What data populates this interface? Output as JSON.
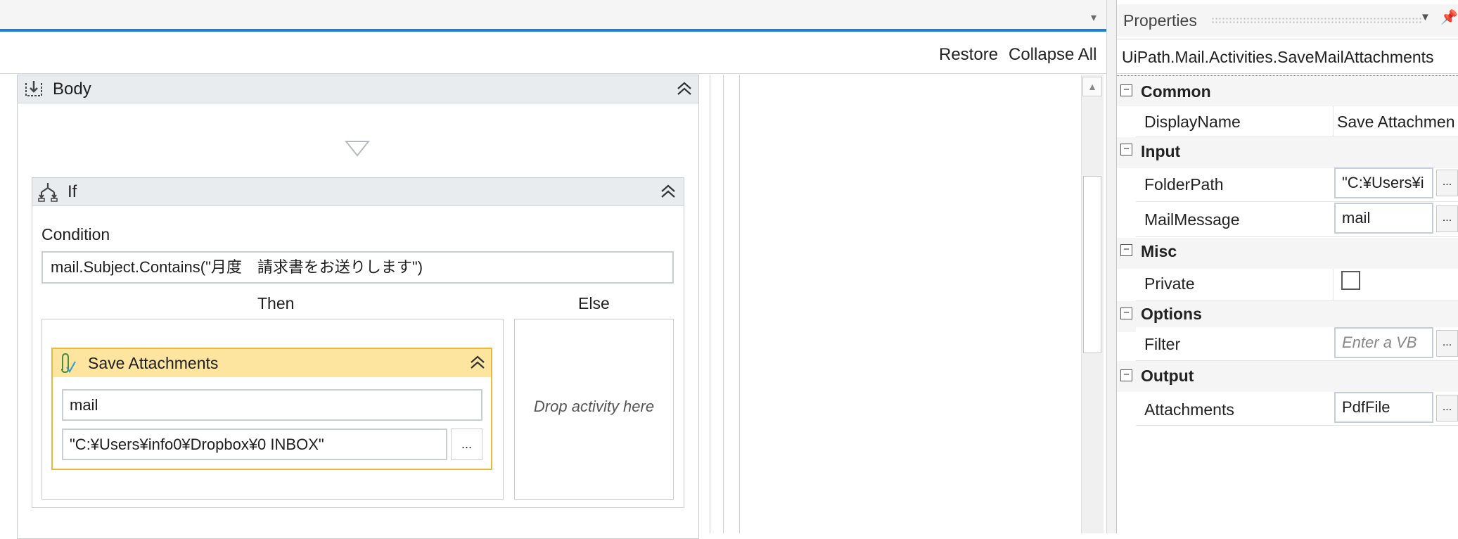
{
  "toolbar": {
    "restore": "Restore",
    "collapse_all": "Collapse All"
  },
  "workflow": {
    "body_title": "Body",
    "if_title": "If",
    "condition_label": "Condition",
    "condition_value": "mail.Subject.Contains(\"月度　請求書をお送りします\")",
    "then_label": "Then",
    "else_label": "Else",
    "drop_hint": "Drop activity here",
    "save_attachments": {
      "title": "Save Attachments",
      "mail_value": "mail",
      "path_value": "\"C:¥Users¥info0¥Dropbox¥0 INBOX\"",
      "browse_label": "..."
    }
  },
  "properties": {
    "title": "Properties",
    "class_name": "UiPath.Mail.Activities.SaveMailAttachments",
    "categories": [
      {
        "label": "Common",
        "toggle": "−",
        "rows": [
          {
            "name": "DisplayName",
            "value": "Save Attachmen"
          }
        ]
      },
      {
        "label": "Input",
        "toggle": "−",
        "rows": [
          {
            "name": "FolderPath",
            "value": "\"C:¥Users¥i"
          },
          {
            "name": "MailMessage",
            "value": "mail"
          }
        ]
      },
      {
        "label": "Misc",
        "toggle": "−",
        "rows": [
          {
            "name": "Private",
            "checked": false
          }
        ]
      },
      {
        "label": "Options",
        "toggle": "−",
        "rows": [
          {
            "name": "Filter",
            "placeholder": "Enter a VB"
          }
        ]
      },
      {
        "label": "Output",
        "toggle": "−",
        "rows": [
          {
            "name": "Attachments",
            "value": "PdfFile"
          }
        ]
      }
    ],
    "browse_label": "..."
  },
  "colors": {
    "accent_blue": "#1a7fd4",
    "activity_header": "#fde59f",
    "activity_border": "#e8b93a",
    "container_header": "#e9ecef"
  },
  "icons": {
    "body": "sequence-icon",
    "if": "if-flow-icon",
    "save_attachments": "paperclip-icon",
    "collapse": "double-chevron-up-icon"
  }
}
